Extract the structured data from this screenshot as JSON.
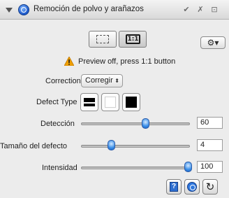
{
  "titlebar": {
    "title": "Remoción de polvo y arañazos",
    "collapse_icon": "disclosure-triangle-icon",
    "logo_icon": "tool-logo-icon",
    "check_icon": "checkmark-icon",
    "close_icon": "close-icon",
    "menu_icon": "panel-menu-icon",
    "check_glyph": "✔",
    "close_glyph": "✗",
    "menu_glyph": "⊡"
  },
  "preview": {
    "split_icon": "split-preview-icon",
    "one_to_one_label": "1:1",
    "gear_glyph": "⚙▾",
    "warning_icon": "warning-icon",
    "warning_text": "Preview off, press 1:1 button"
  },
  "correction": {
    "label": "Correction",
    "value": "Corregir",
    "arrow_glyph": "⬍"
  },
  "defect_type": {
    "label": "Defect Type",
    "options": [
      "dark",
      "light",
      "both"
    ]
  },
  "sliders": {
    "deteccion": {
      "label": "Detección",
      "value": "60"
    },
    "tamano": {
      "label": "Tamaño del defecto",
      "value": "4"
    },
    "intensidad": {
      "label": "Intensidad",
      "value": "100"
    }
  },
  "bottom": {
    "help_label": "?",
    "refresh_glyph": "↻"
  },
  "colors": {
    "panel_bg": "#ececec",
    "accent": "#3b8fe8",
    "warning": "#f0a000"
  }
}
